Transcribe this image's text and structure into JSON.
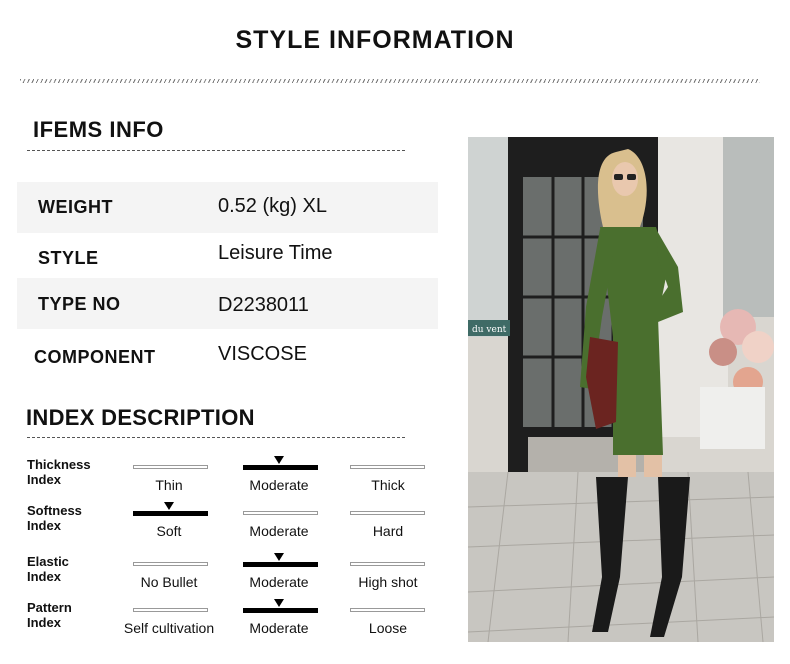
{
  "header": {
    "title": "STYLE INFORMATION"
  },
  "items_info": {
    "heading": "IFEMS INFO",
    "rows": [
      {
        "label": "WEIGHT",
        "value": "0.52  (kg)  XL"
      },
      {
        "label": "STYLE",
        "value": "Leisure Time"
      },
      {
        "label": "TYPE NO",
        "value": "D2238011"
      },
      {
        "label": "COMPONENT",
        "value": "VISCOSE"
      }
    ]
  },
  "index_description": {
    "heading": "INDEX DESCRIPTION",
    "rows": [
      {
        "label_line1": "Thickness",
        "label_line2": "Index",
        "options": [
          "Thin",
          "Moderate",
          "Thick"
        ],
        "selected_index": 1
      },
      {
        "label_line1": "Softness",
        "label_line2": "Index",
        "options": [
          "Soft",
          "Moderate",
          "Hard"
        ],
        "selected_index": 0
      },
      {
        "label_line1": "Elastic",
        "label_line2": "Index",
        "options": [
          "No Bullet",
          "Moderate",
          "High shot"
        ],
        "selected_index": 1
      },
      {
        "label_line1": "Pattern",
        "label_line2": "Index",
        "options": [
          "Self cultivation",
          "Moderate",
          "Loose"
        ],
        "selected_index": 1
      }
    ]
  },
  "product_photo": {
    "icon": "product-photo",
    "dress_color": "#4a6f2e",
    "boot_color": "#1a1a1a",
    "sign_text": "du vent"
  }
}
